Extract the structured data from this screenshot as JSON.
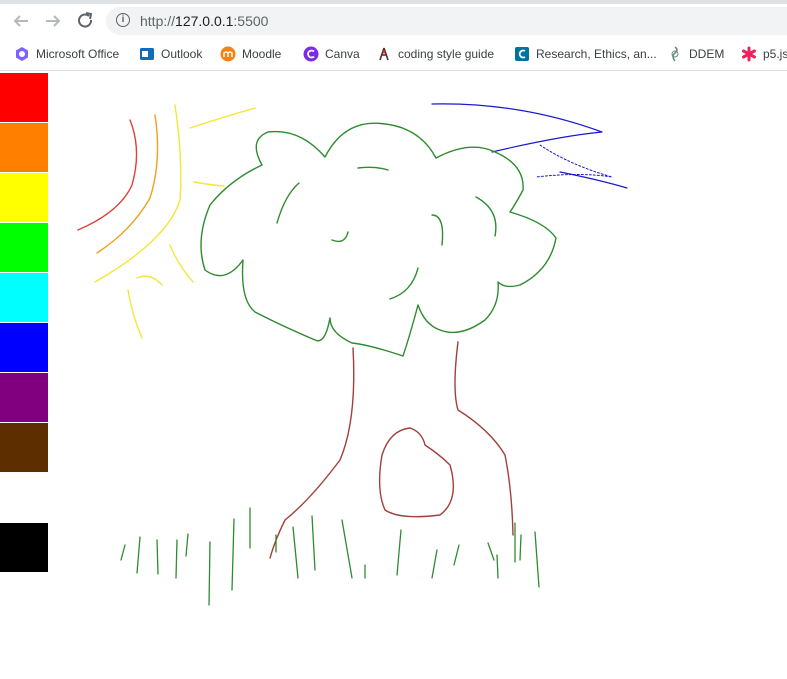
{
  "browser": {
    "address": {
      "protocol": "http://",
      "host": "127.0.0.1",
      "port": ":5500"
    }
  },
  "bookmarks": [
    {
      "label": "Microsoft Office",
      "icon": "office-icon",
      "color": "#7b61ff"
    },
    {
      "label": "Outlook",
      "icon": "outlook-icon",
      "color": "#0f6cbd"
    },
    {
      "label": "Moodle",
      "icon": "moodle-icon",
      "color": "#f98012"
    },
    {
      "label": "Canva",
      "icon": "canva-icon",
      "color": "#7d2ae8"
    },
    {
      "label": "coding style guide",
      "icon": "guide-icon",
      "color": "#5a2d2d"
    },
    {
      "label": "Research, Ethics, an...",
      "icon": "research-icon",
      "color": "#00729c"
    },
    {
      "label": "DDEM",
      "icon": "ddem-icon",
      "color": "#6b8e7f"
    },
    {
      "label": "p5.js",
      "icon": "p5-icon",
      "color": "#ed225d"
    }
  ],
  "palette": [
    {
      "name": "red",
      "color": "#ff0000"
    },
    {
      "name": "orange",
      "color": "#ff7f00"
    },
    {
      "name": "yellow",
      "color": "#ffff00"
    },
    {
      "name": "green",
      "color": "#00ff00"
    },
    {
      "name": "cyan",
      "color": "#00ffff"
    },
    {
      "name": "blue",
      "color": "#0000ff"
    },
    {
      "name": "purple",
      "color": "#800080"
    },
    {
      "name": "brown",
      "color": "#5c2e00"
    },
    {
      "name": "white",
      "color": "#ffffff"
    },
    {
      "name": "black",
      "color": "#000000"
    }
  ],
  "drawing": {
    "stroke_colors": {
      "tree": "#2e8b2e",
      "trunk": "#a0403a",
      "sun_red": "#e0403a",
      "sun_orange": "#f0a020",
      "sun_yellow": "#f5e636",
      "wind": "#1a1acc",
      "grass": "#2e8b2e"
    }
  }
}
